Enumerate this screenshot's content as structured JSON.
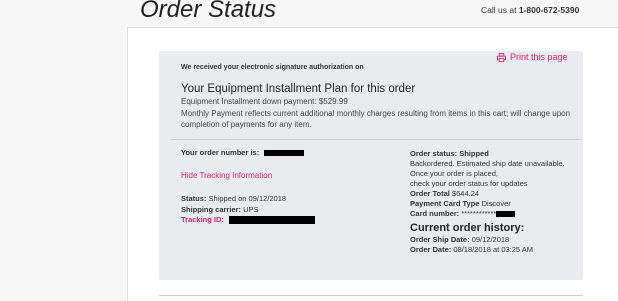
{
  "header": {
    "title": "Order Status",
    "call_us_prefix": "Call us at",
    "phone": "1-800-672-5390"
  },
  "card": {
    "print_label": "Print this page",
    "signature_text": "We received your electronic signature authorization on",
    "plan_title": "Your Equipment Installment Plan for this order",
    "down_payment": "Equipment Installment down payment: $529.99",
    "monthly_note": "Monthly Payment reflects current additional monthly charges resulting from items in this cart; will change upon completion of payments for any item."
  },
  "left": {
    "order_number_label": "Your order number is:",
    "hide_tracking": "Hide Tracking Information",
    "status_label": "Status:",
    "status_value": "Shipped on 09/12/2018",
    "carrier_label": "Shipping carrier:",
    "carrier_value": "UPS",
    "tracking_label": "Tracking ID:"
  },
  "right": {
    "order_status_label": "Order status:",
    "order_status_value": "Shipped",
    "backordered": "Backordered. Estimated ship date unavailable.",
    "once_placed": "Once your order is placed,",
    "check_status": "check your order status for updates",
    "total_label": "Order Total",
    "total_value": "$644.24",
    "payment_type_label": "Payment Card Type",
    "payment_type_value": "Discover",
    "card_number_label": "Card number:",
    "card_number_mask": "************",
    "history_title": "Current order history:",
    "ship_date_label": "Order Ship Date:",
    "ship_date_value": "09/12/2018",
    "order_date_label": "Order Date:",
    "order_date_value": "08/18/2018 at 03:25 AM"
  },
  "colors": {
    "accent": "#d6246e",
    "card_bg": "#e9ecef"
  }
}
